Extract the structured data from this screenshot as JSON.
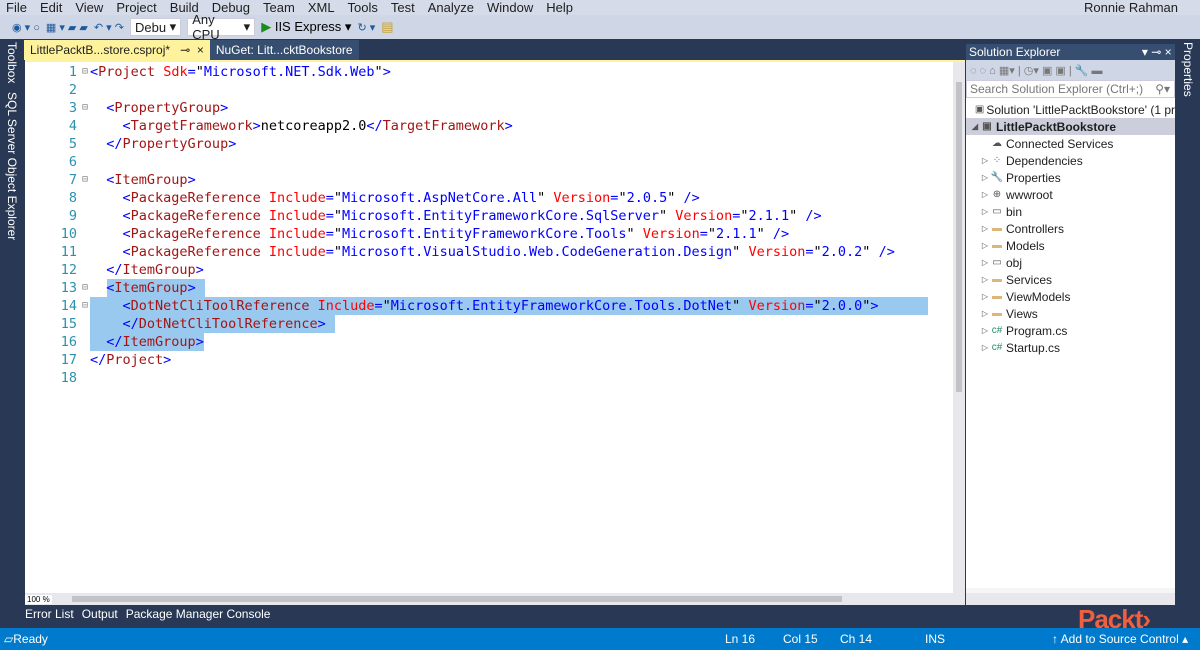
{
  "menu": [
    "File",
    "Edit",
    "View",
    "Project",
    "Build",
    "Debug",
    "Team",
    "XML",
    "Tools",
    "Test",
    "Analyze",
    "Window",
    "Help"
  ],
  "user": "Ronnie Rahman",
  "toolbar": {
    "config": "Debu",
    "platform": "Any CPU",
    "run": "IIS Express"
  },
  "left_strip": [
    "Toolbox",
    "SQL Server Object Explorer"
  ],
  "tabs": [
    {
      "label": "LittlePacktB...store.csproj*"
    },
    {
      "label": "NuGet: Litt...cktBookstore"
    }
  ],
  "code": [
    [
      [
        "d",
        "<"
      ],
      [
        "e",
        "Project"
      ],
      [
        "x",
        " "
      ],
      [
        "a",
        "Sdk"
      ],
      [
        "d",
        "="
      ],
      [
        "q",
        "\""
      ],
      [
        "v",
        "Microsoft.NET.Sdk.Web"
      ],
      [
        "q",
        "\""
      ],
      [
        "d",
        ">"
      ]
    ],
    [],
    [
      [
        "x",
        "  "
      ],
      [
        "d",
        "<"
      ],
      [
        "e",
        "PropertyGroup"
      ],
      [
        "d",
        ">"
      ]
    ],
    [
      [
        "x",
        "    "
      ],
      [
        "d",
        "<"
      ],
      [
        "e",
        "TargetFramework"
      ],
      [
        "d",
        ">"
      ],
      [
        "x",
        "netcoreapp2.0"
      ],
      [
        "d",
        "</"
      ],
      [
        "e",
        "TargetFramework"
      ],
      [
        "d",
        ">"
      ]
    ],
    [
      [
        "x",
        "  "
      ],
      [
        "d",
        "</"
      ],
      [
        "e",
        "PropertyGroup"
      ],
      [
        "d",
        ">"
      ]
    ],
    [],
    [
      [
        "x",
        "  "
      ],
      [
        "d",
        "<"
      ],
      [
        "e",
        "ItemGroup"
      ],
      [
        "d",
        ">"
      ]
    ],
    [
      [
        "x",
        "    "
      ],
      [
        "d",
        "<"
      ],
      [
        "e",
        "PackageReference"
      ],
      [
        "x",
        " "
      ],
      [
        "a",
        "Include"
      ],
      [
        "d",
        "="
      ],
      [
        "q",
        "\""
      ],
      [
        "v",
        "Microsoft.AspNetCore.All"
      ],
      [
        "q",
        "\""
      ],
      [
        "x",
        " "
      ],
      [
        "a",
        "Version"
      ],
      [
        "d",
        "="
      ],
      [
        "q",
        "\""
      ],
      [
        "v",
        "2.0.5"
      ],
      [
        "q",
        "\""
      ],
      [
        "x",
        " "
      ],
      [
        "d",
        "/>"
      ]
    ],
    [
      [
        "x",
        "    "
      ],
      [
        "d",
        "<"
      ],
      [
        "e",
        "PackageReference"
      ],
      [
        "x",
        " "
      ],
      [
        "a",
        "Include"
      ],
      [
        "d",
        "="
      ],
      [
        "q",
        "\""
      ],
      [
        "v",
        "Microsoft.EntityFrameworkCore.SqlServer"
      ],
      [
        "q",
        "\""
      ],
      [
        "x",
        " "
      ],
      [
        "a",
        "Version"
      ],
      [
        "d",
        "="
      ],
      [
        "q",
        "\""
      ],
      [
        "v",
        "2.1.1"
      ],
      [
        "q",
        "\""
      ],
      [
        "x",
        " "
      ],
      [
        "d",
        "/>"
      ]
    ],
    [
      [
        "x",
        "    "
      ],
      [
        "d",
        "<"
      ],
      [
        "e",
        "PackageReference"
      ],
      [
        "x",
        " "
      ],
      [
        "a",
        "Include"
      ],
      [
        "d",
        "="
      ],
      [
        "q",
        "\""
      ],
      [
        "v",
        "Microsoft.EntityFrameworkCore.Tools"
      ],
      [
        "q",
        "\""
      ],
      [
        "x",
        " "
      ],
      [
        "a",
        "Version"
      ],
      [
        "d",
        "="
      ],
      [
        "q",
        "\""
      ],
      [
        "v",
        "2.1.1"
      ],
      [
        "q",
        "\""
      ],
      [
        "x",
        " "
      ],
      [
        "d",
        "/>"
      ]
    ],
    [
      [
        "x",
        "    "
      ],
      [
        "d",
        "<"
      ],
      [
        "e",
        "PackageReference"
      ],
      [
        "x",
        " "
      ],
      [
        "a",
        "Include"
      ],
      [
        "d",
        "="
      ],
      [
        "q",
        "\""
      ],
      [
        "v",
        "Microsoft.VisualStudio.Web.CodeGeneration.Design"
      ],
      [
        "q",
        "\""
      ],
      [
        "x",
        " "
      ],
      [
        "a",
        "Version"
      ],
      [
        "d",
        "="
      ],
      [
        "q",
        "\""
      ],
      [
        "v",
        "2.0.2"
      ],
      [
        "q",
        "\""
      ],
      [
        "x",
        " "
      ],
      [
        "d",
        "/>"
      ]
    ],
    [
      [
        "x",
        "  "
      ],
      [
        "d",
        "</"
      ],
      [
        "e",
        "ItemGroup"
      ],
      [
        "d",
        ">"
      ]
    ],
    [
      [
        "x",
        "  "
      ],
      [
        "d",
        "<"
      ],
      [
        "e",
        "ItemGroup"
      ],
      [
        "d",
        ">"
      ]
    ],
    [
      [
        "x",
        "    "
      ],
      [
        "d",
        "<"
      ],
      [
        "e",
        "DotNetCliToolReference"
      ],
      [
        "x",
        " "
      ],
      [
        "a",
        "Include"
      ],
      [
        "d",
        "="
      ],
      [
        "q",
        "\""
      ],
      [
        "v",
        "Microsoft.EntityFrameworkCore.Tools.DotNet"
      ],
      [
        "q",
        "\""
      ],
      [
        "x",
        " "
      ],
      [
        "a",
        "Version"
      ],
      [
        "d",
        "="
      ],
      [
        "q",
        "\""
      ],
      [
        "v",
        "2.0.0"
      ],
      [
        "q",
        "\""
      ],
      [
        "d",
        ">"
      ]
    ],
    [
      [
        "x",
        "    "
      ],
      [
        "d",
        "</"
      ],
      [
        "e",
        "DotNetCliToolReference"
      ],
      [
        "d",
        ">"
      ]
    ],
    [
      [
        "x",
        "  "
      ],
      [
        "d",
        "</"
      ],
      [
        "e",
        "ItemGroup"
      ],
      [
        "d",
        ">"
      ]
    ],
    [
      [
        "d",
        "</"
      ],
      [
        "e",
        "Project"
      ],
      [
        "d",
        ">"
      ]
    ],
    []
  ],
  "zoom": "100 %",
  "solution_explorer": {
    "title": "Solution Explorer",
    "search_placeholder": "Search Solution Explorer (Ctrl+;)",
    "nodes": [
      {
        "label": "Solution 'LittlePacktBookstore' (1 pr",
        "icon": "▣",
        "level": 0,
        "exp": ""
      },
      {
        "label": "LittlePacktBookstore",
        "icon": "▣",
        "level": 0,
        "exp": "◢",
        "selected": true
      },
      {
        "label": "Connected Services",
        "icon": "☁",
        "level": 1,
        "exp": ""
      },
      {
        "label": "Dependencies",
        "icon": "⁘",
        "level": 1,
        "exp": "▷"
      },
      {
        "label": "Properties",
        "icon": "🔧",
        "level": 1,
        "exp": "▷"
      },
      {
        "label": "wwwroot",
        "icon": "⊕",
        "level": 1,
        "exp": "▷"
      },
      {
        "label": "bin",
        "icon": "▭",
        "level": 1,
        "exp": "▷"
      },
      {
        "label": "Controllers",
        "icon": "▬",
        "level": 1,
        "exp": "▷",
        "folder": true
      },
      {
        "label": "Models",
        "icon": "▬",
        "level": 1,
        "exp": "▷",
        "folder": true
      },
      {
        "label": "obj",
        "icon": "▭",
        "level": 1,
        "exp": "▷"
      },
      {
        "label": "Services",
        "icon": "▬",
        "level": 1,
        "exp": "▷",
        "folder": true
      },
      {
        "label": "ViewModels",
        "icon": "▬",
        "level": 1,
        "exp": "▷",
        "folder": true
      },
      {
        "label": "Views",
        "icon": "▬",
        "level": 1,
        "exp": "▷",
        "folder": true
      },
      {
        "label": "Program.cs",
        "icon": "c#",
        "level": 1,
        "exp": "▷",
        "cs": true
      },
      {
        "label": "Startup.cs",
        "icon": "c#",
        "level": 1,
        "exp": "▷",
        "cs": true
      }
    ]
  },
  "properties_strip": "Properties",
  "bottom_tabs": [
    "Error List",
    "Output",
    "Package Manager Console"
  ],
  "status": {
    "ready": "Ready",
    "ln": "Ln 16",
    "col": "Col 15",
    "ch": "Ch 14",
    "ins": "INS",
    "source": "↑ Add to Source Control ▴"
  },
  "logo": "Packt>"
}
